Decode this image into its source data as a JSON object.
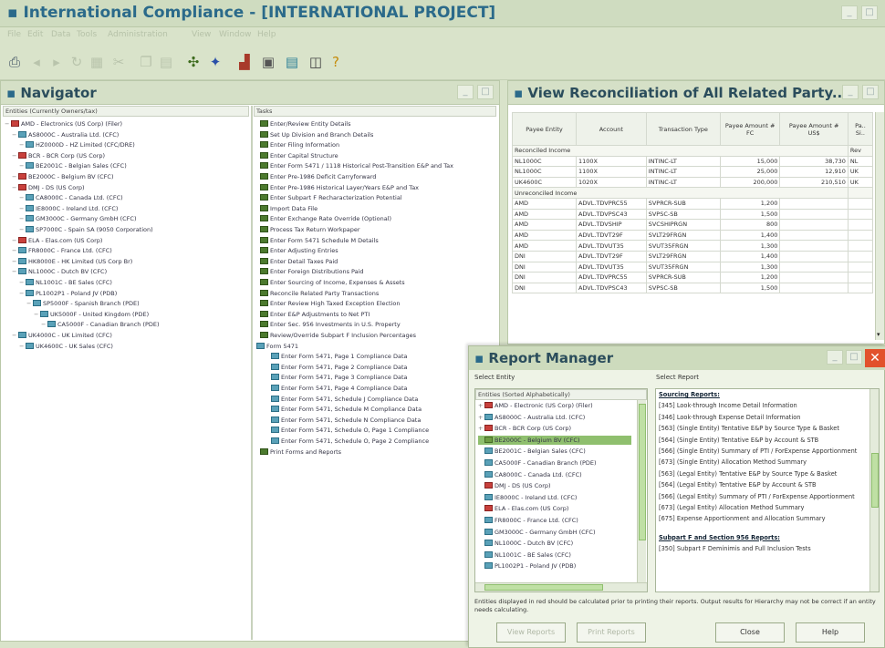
{
  "app": {
    "title": "International Compliance - [INTERNATIONAL PROJECT]",
    "menu": [
      "File",
      "Edit",
      "Data",
      "Tools",
      "Administration",
      "View",
      "Window",
      "Help"
    ]
  },
  "navigator": {
    "title": "Navigator",
    "entities_header": "Entities (Currently Owners/tax)",
    "tasks_header": "Tasks",
    "entities": [
      {
        "label": "AMD - Electronics (US Corp) (Filer)",
        "level": 0,
        "icon": "red"
      },
      {
        "label": "AS8000C - Australia Ltd. (CFC)",
        "level": 1,
        "icon": "blue"
      },
      {
        "label": "HZ0000D - HZ Limited (CFC/DRE)",
        "level": 2,
        "icon": "blue"
      },
      {
        "label": "BCR - BCR Corp (US Corp)",
        "level": 1,
        "icon": "red"
      },
      {
        "label": "BE2001C - Belgian Sales (CFC)",
        "level": 2,
        "icon": "blue"
      },
      {
        "label": "BE2000C - Belgium BV (CFC)",
        "level": 1,
        "icon": "red"
      },
      {
        "label": "DMJ - DS (US Corp)",
        "level": 1,
        "icon": "red"
      },
      {
        "label": "CA8000C - Canada Ltd. (CFC)",
        "level": 2,
        "icon": "blue"
      },
      {
        "label": "IE8000C - Ireland Ltd. (CFC)",
        "level": 2,
        "icon": "blue"
      },
      {
        "label": "GM3000C - Germany GmbH (CFC)",
        "level": 2,
        "icon": "blue"
      },
      {
        "label": "SP7000C - Spain SA (9050 Corporation)",
        "level": 2,
        "icon": "blue"
      },
      {
        "label": "ELA - Elas.com (US Corp)",
        "level": 1,
        "icon": "red"
      },
      {
        "label": "FR8000C - France Ltd. (CFC)",
        "level": 1,
        "icon": "blue"
      },
      {
        "label": "HK8000E - HK Limited (US Corp Br)",
        "level": 1,
        "icon": "blue"
      },
      {
        "label": "NL1000C - Dutch BV (CFC)",
        "level": 1,
        "icon": "blue"
      },
      {
        "label": "NL1001C - BE Sales (CFC)",
        "level": 2,
        "icon": "blue"
      },
      {
        "label": "PL1002P1 - Poland JV (PDB)",
        "level": 2,
        "icon": "blue"
      },
      {
        "label": "SP5000F - Spanish Branch (PDE)",
        "level": 3,
        "icon": "blue"
      },
      {
        "label": "UK5000F - United Kingdom (PDE)",
        "level": 4,
        "icon": "blue"
      },
      {
        "label": "CA5000F - Canadian Branch (PDE)",
        "level": 5,
        "icon": "blue"
      },
      {
        "label": "UK4000C - UK Limited (CFC)",
        "level": 1,
        "icon": "blue"
      },
      {
        "label": "UK4600C - UK Sales (CFC)",
        "level": 2,
        "icon": "blue"
      }
    ],
    "tasks": [
      "Enter/Review Entity Details",
      "Set Up Division and Branch Details",
      "Enter Filing Information",
      "Enter Capital Structure",
      "Enter Form 5471 / 1118 Historical Post-Transition E&P and Tax",
      "Enter Pre-1986 Deficit Carryforward",
      "Enter Pre-1986 Historical Layer/Years E&P and Tax",
      "Enter Subpart F Recharacterization Potential",
      "Import Data File",
      "Enter Exchange Rate Override (Optional)",
      "Process Tax Return Workpaper",
      "Enter Form 5471 Schedule M Details",
      "Enter Adjusting Entries",
      "Enter Detail Taxes Paid",
      "Enter Foreign Distributions Paid",
      "Enter Sourcing of Income, Expenses & Assets",
      "Reconcile Related Party Transactions",
      "Enter Review High Taxed Exception Election",
      "Enter E&P Adjustments to Net PTI",
      "Enter Sec. 956 Investments in U.S. Property",
      "Review/Override Subpart F Inclusion Percentages",
      "Form 5471",
      "Enter Form 5471, Page 1 Compliance Data",
      "Enter Form 5471, Page 2 Compliance Data",
      "Enter Form 5471, Page 3 Compliance Data",
      "Enter Form 5471, Page 4 Compliance Data",
      "Enter Form 5471, Schedule J Compliance Data",
      "Enter Form 5471, Schedule M Compliance Data",
      "Enter Form 5471, Schedule N Compliance Data",
      "Enter Form 5471, Schedule O, Page 1 Compliance",
      "Enter Form 5471, Schedule O, Page 2 Compliance",
      "Print Forms and Reports"
    ]
  },
  "recon": {
    "title": "View Reconciliation of All Related Party...",
    "columns": [
      "Payee Entity",
      "Account",
      "Transaction Type",
      "Payee Amount # FC",
      "Payee Amount # US$",
      "Pa.. Si.."
    ],
    "sections": [
      {
        "label": "Reconciled Income",
        "tail": "Rev",
        "rows": [
          [
            "NL1000C",
            "1100X",
            "INTINC-LT",
            "15,000",
            "38,730",
            "NL"
          ],
          [
            "NL1000C",
            "1100X",
            "INTINC-LT",
            "25,000",
            "12,910",
            "UK"
          ],
          [
            "UK4600C",
            "1020X",
            "INTINC-LT",
            "200,000",
            "210,510",
            "UK"
          ]
        ]
      },
      {
        "label": "Unreconciled Income",
        "tail": "",
        "rows": [
          [
            "AMD",
            "ADVL.TDVPRC55",
            "SVPRCR-SUB",
            "1,200",
            "",
            ""
          ],
          [
            "AMD",
            "ADVL.TDVPSC43",
            "SVPSC-SB",
            "1,500",
            "",
            ""
          ],
          [
            "AMD",
            "ADVL.TDVSHIP",
            "SVCSHIPRGN",
            "800",
            "",
            ""
          ],
          [
            "AMD",
            "ADVL.TDVT29F",
            "SVLT29FRGN",
            "1,400",
            "",
            ""
          ],
          [
            "AMD",
            "ADVL.TDVUT35",
            "SVUT35FRGN",
            "1,300",
            "",
            ""
          ],
          [
            "DNI",
            "ADVL.TDVT29F",
            "SVLT29FRGN",
            "1,400",
            "",
            ""
          ],
          [
            "DNI",
            "ADVL.TDVUT35",
            "SVUT35FRGN",
            "1,300",
            "",
            ""
          ],
          [
            "DNI",
            "ADVL.TDVPRC55",
            "SVPRCR-SUB",
            "1,200",
            "",
            ""
          ],
          [
            "DNI",
            "ADVL.TDVPSC43",
            "SVPSC-SB",
            "1,500",
            "",
            ""
          ]
        ]
      }
    ]
  },
  "report": {
    "title": "Report Manager",
    "select_entity_label": "Select Entity",
    "select_report_label": "Select Report",
    "entities_header": "Entities (Sorted Alphabetically)",
    "entities": [
      {
        "label": "AMD - Electronic (US Corp) (Filer)",
        "icon": "red"
      },
      {
        "label": "AS8000C - Australia Ltd. (CFC)",
        "icon": "blue"
      },
      {
        "label": "BCR - BCR Corp (US Corp)",
        "icon": "red"
      },
      {
        "label": "BE2000C - Belgium BV (CFC)",
        "icon": "gr",
        "selected": true
      },
      {
        "label": "BE2001C - Belgian Sales (CFC)",
        "icon": "blue"
      },
      {
        "label": "CA5000F - Canadian Branch (PDE)",
        "icon": "blue"
      },
      {
        "label": "CA8000C - Canada Ltd. (CFC)",
        "icon": "blue"
      },
      {
        "label": "DMJ - DS (US Corp)",
        "icon": "red"
      },
      {
        "label": "IE8000C - Ireland Ltd. (CFC)",
        "icon": "blue"
      },
      {
        "label": "ELA - Elas.com (US Corp)",
        "icon": "red"
      },
      {
        "label": "FR8000C - France Ltd. (CFC)",
        "icon": "blue"
      },
      {
        "label": "GM3000C - Germany GmbH (CFC)",
        "icon": "blue"
      },
      {
        "label": "NL1000C - Dutch BV (CFC)",
        "icon": "blue"
      },
      {
        "label": "NL1001C - BE Sales (CFC)",
        "icon": "blue"
      },
      {
        "label": "PL1002P1 - Poland JV (PDB)",
        "icon": "blue"
      }
    ],
    "reports": [
      {
        "label": "Sourcing Reports:",
        "head": true
      },
      {
        "label": "[345] Look-through Income Detail Information"
      },
      {
        "label": "[346] Look-through Expense Detail Information"
      },
      {
        "label": "[563] (Single Entity) Tentative E&P by Source Type & Basket"
      },
      {
        "label": "[564] (Single Entity) Tentative E&P by Account & STB"
      },
      {
        "label": "[566] (Single Entity) Summary of PTI / ForExpense Apportionment"
      },
      {
        "label": "[673] (Single Entity) Allocation Method Summary"
      },
      {
        "label": "[563] (Legal Entity) Tentative E&P by Source Type & Basket"
      },
      {
        "label": "[564] (Legal Entity) Tentative E&P by Account & STB"
      },
      {
        "label": "[566] (Legal Entity) Summary of PTI / ForExpense Apportionment"
      },
      {
        "label": "[673] (Legal Entity) Allocation Method Summary"
      },
      {
        "label": "[675] Expense Apportionment and Allocation Summary"
      },
      {
        "label": "",
        "gap": true
      },
      {
        "label": "Subpart F and Section 956 Reports:",
        "head": true
      },
      {
        "label": "[350] Subpart F Deminimis and Full Inclusion Tests"
      }
    ],
    "note": "Entities displayed in red should be calculated prior to printing their reports. Output results for Hierarchy may not be correct if an entity needs calculating.",
    "buttons": {
      "view": "View Reports",
      "print": "Print Reports",
      "close": "Close",
      "help": "Help"
    }
  },
  "colors": {
    "accent": "#2b6a8a",
    "panel": "#d9e3ca",
    "close": "#e2512b"
  }
}
